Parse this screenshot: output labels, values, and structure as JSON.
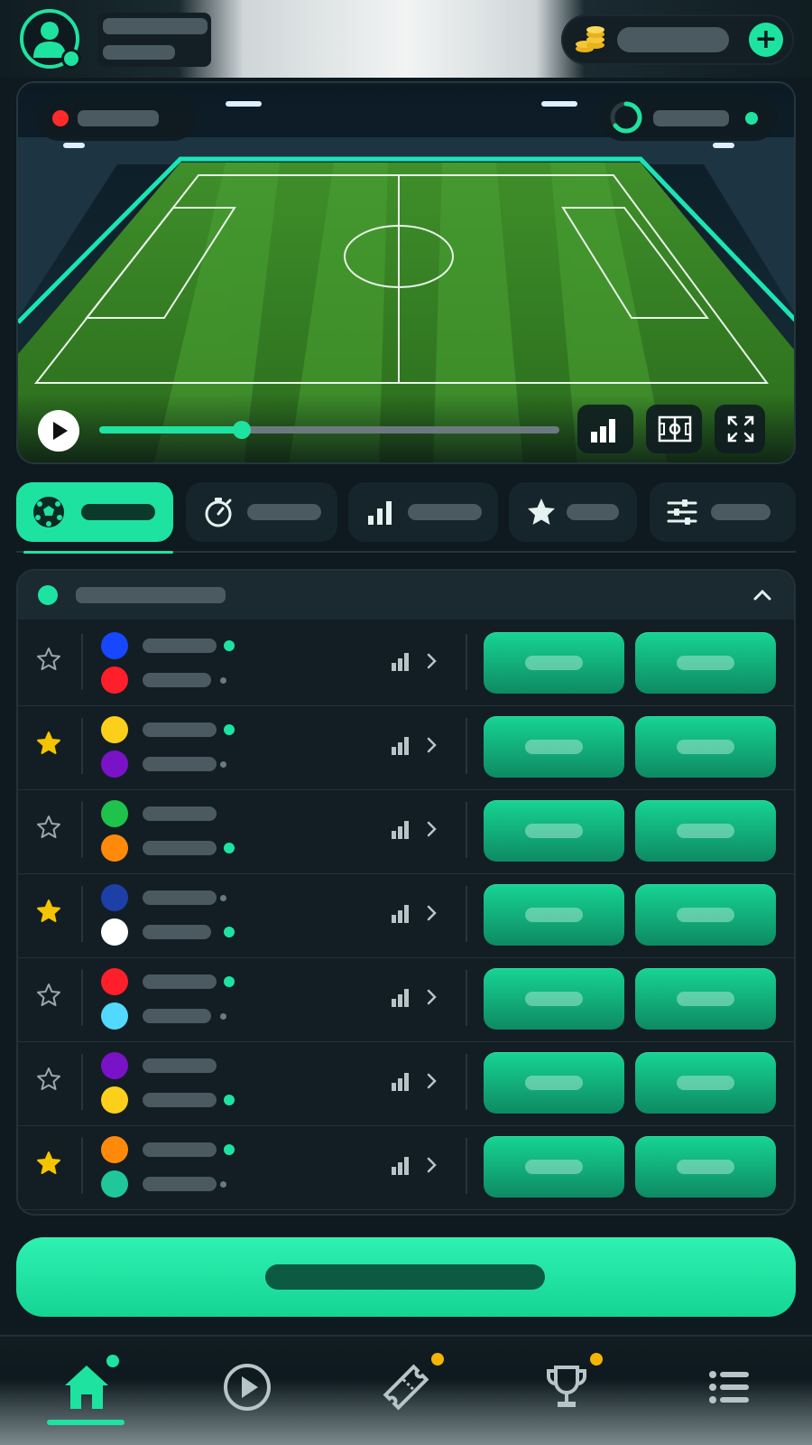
{
  "colors": {
    "accent": "#1ee3a0",
    "background": "#0e1a1f",
    "live": "#ff2a2a",
    "badge": "#f5b500",
    "favorite": "#f5c400"
  },
  "player": {
    "progress": 0.31
  },
  "matches": [
    {
      "favorite": false,
      "home_color": "#1747ff",
      "away_color": "#ff1f2a",
      "home_indicator": "accent",
      "away_indicator": "muted"
    },
    {
      "favorite": true,
      "home_color": "#fcd01a",
      "away_color": "#7a12c8",
      "home_indicator": "accent",
      "away_indicator": "muted"
    },
    {
      "favorite": false,
      "home_color": "#1fc24a",
      "away_color": "#ff8a0a",
      "home_indicator": "none",
      "away_indicator": "accent"
    },
    {
      "favorite": true,
      "home_color": "#1d3fa8",
      "away_color": "#ffffff",
      "home_indicator": "muted",
      "away_indicator": "accent"
    },
    {
      "favorite": false,
      "home_color": "#ff1f2a",
      "away_color": "#52d9ff",
      "home_indicator": "accent",
      "away_indicator": "muted"
    },
    {
      "favorite": false,
      "home_color": "#7a12c8",
      "away_color": "#fcd01a",
      "home_indicator": "none",
      "away_indicator": "accent"
    },
    {
      "favorite": true,
      "home_color": "#ff8a0a",
      "away_color": "#1fc79a",
      "home_indicator": "accent",
      "away_indicator": "muted"
    }
  ]
}
